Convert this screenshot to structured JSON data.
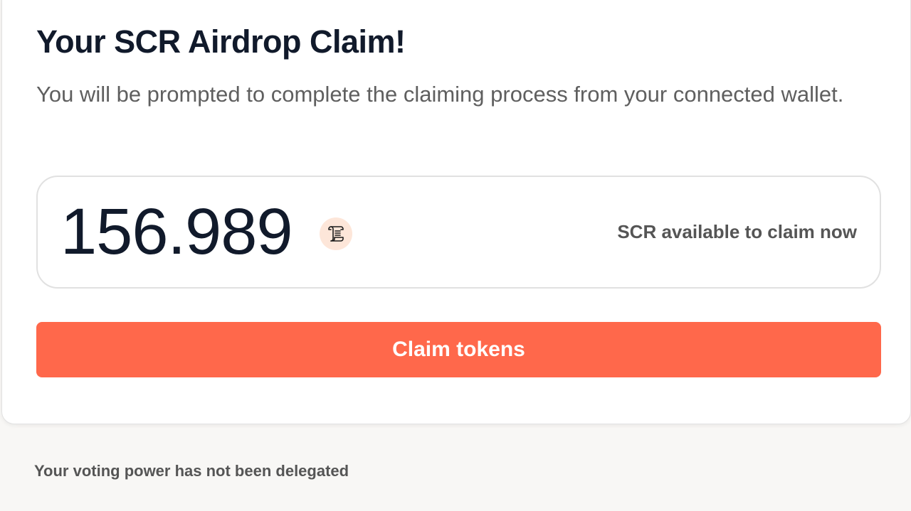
{
  "claim_card": {
    "title": "Your SCR Airdrop Claim!",
    "subtitle": "You will be prompted to complete the claiming process from your connected wallet.",
    "amount": "156.989",
    "amount_icon": "scroll-icon",
    "amount_caption": "SCR available to claim now",
    "claim_button_label": "Claim tokens"
  },
  "voting_note": "Your voting power has not been delegated",
  "colors": {
    "accent": "#ff684b",
    "title": "#111a2b",
    "icon_bg": "#fde6d9"
  }
}
